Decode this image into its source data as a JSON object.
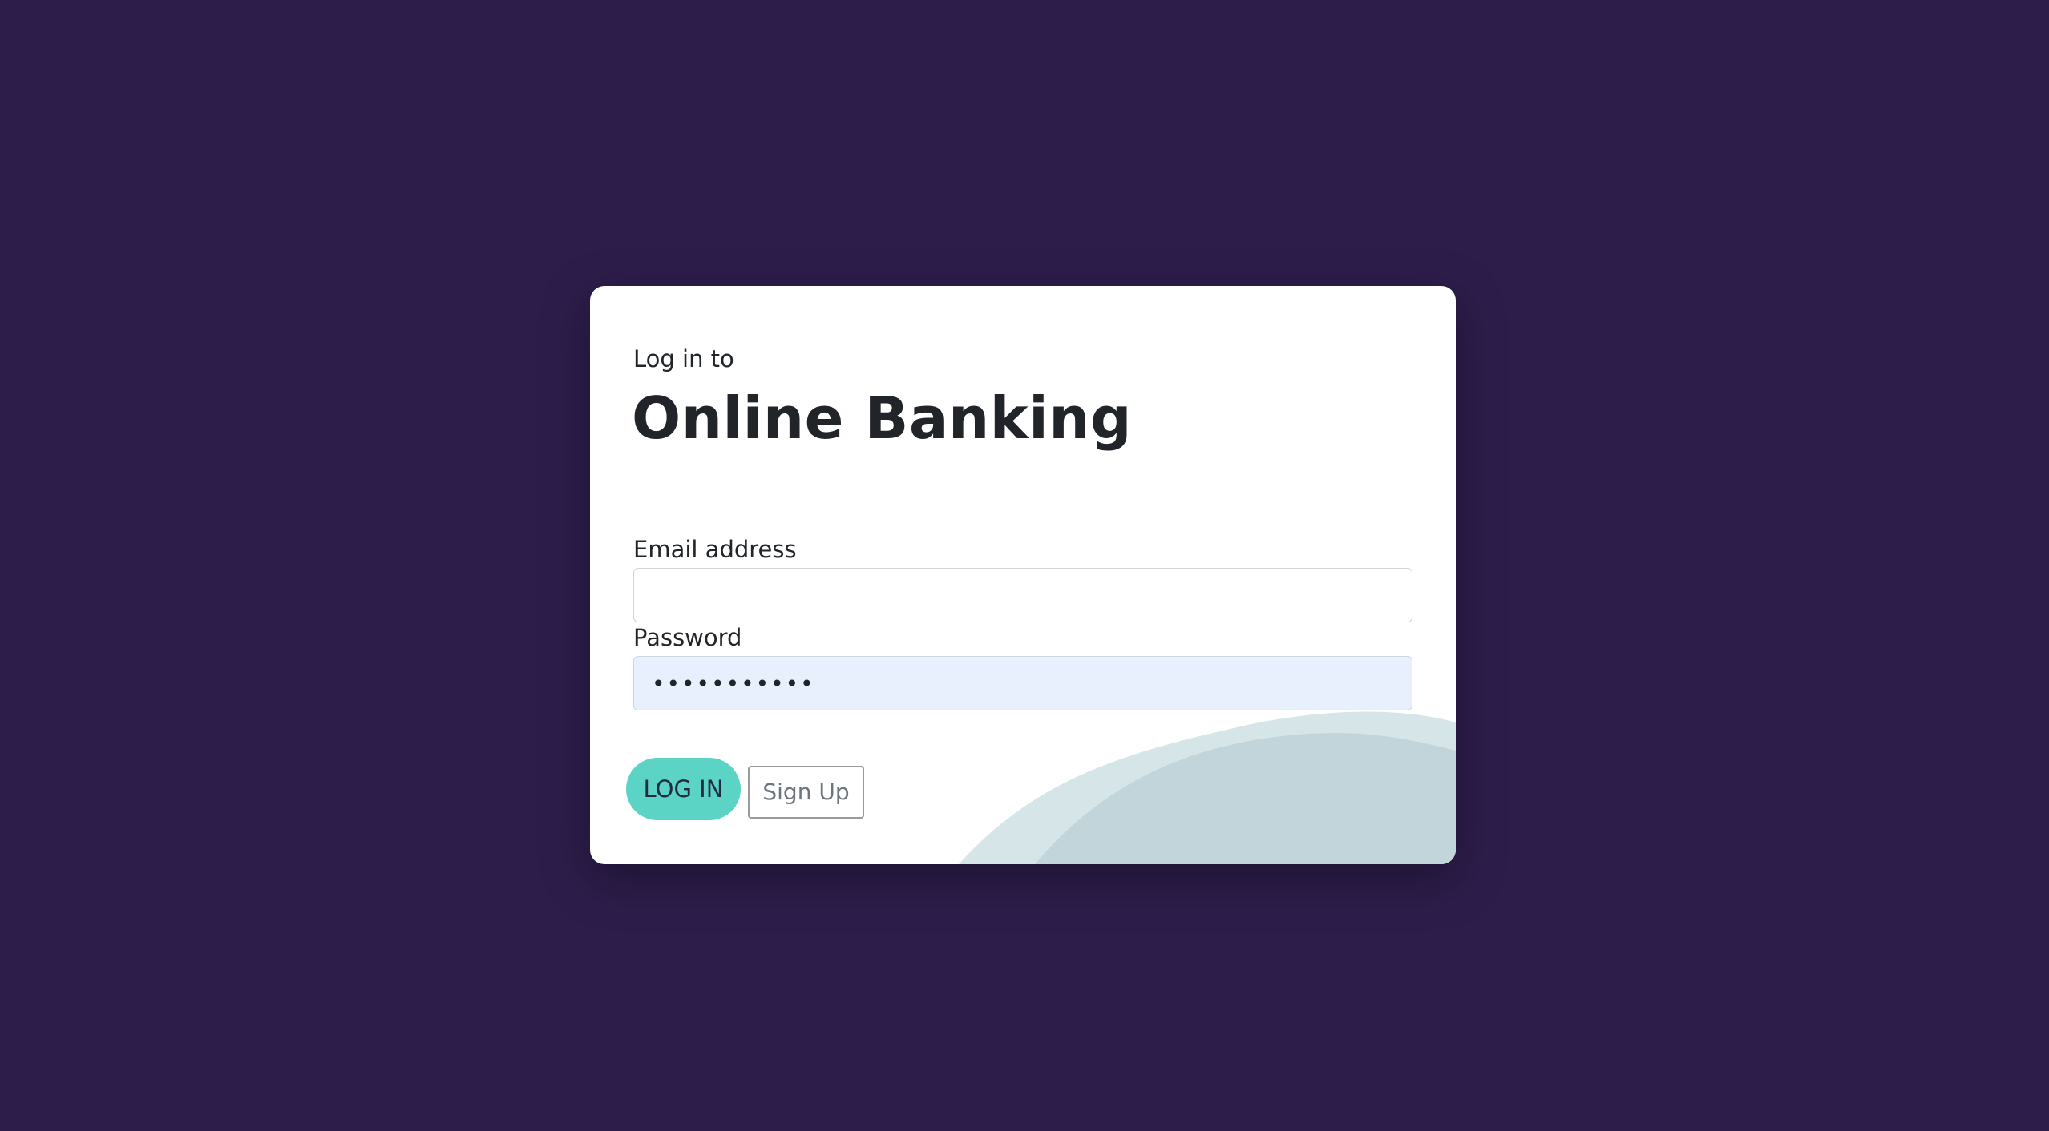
{
  "login_card": {
    "subtitle": "Log in to",
    "title": "Online Banking"
  },
  "form": {
    "email_label": "Email address",
    "email_value": "",
    "password_label": "Password",
    "password_value": "•••••••••••"
  },
  "buttons": {
    "login_label": "LOG IN",
    "signup_label": "Sign Up"
  },
  "colors": {
    "background": "#2d1d4b",
    "card": "#ffffff",
    "primary_button": "#5bd3c5",
    "wave_light": "#d6e6e8",
    "wave_dark": "#c1d5db",
    "autofill_field": "#e8f0fe"
  }
}
